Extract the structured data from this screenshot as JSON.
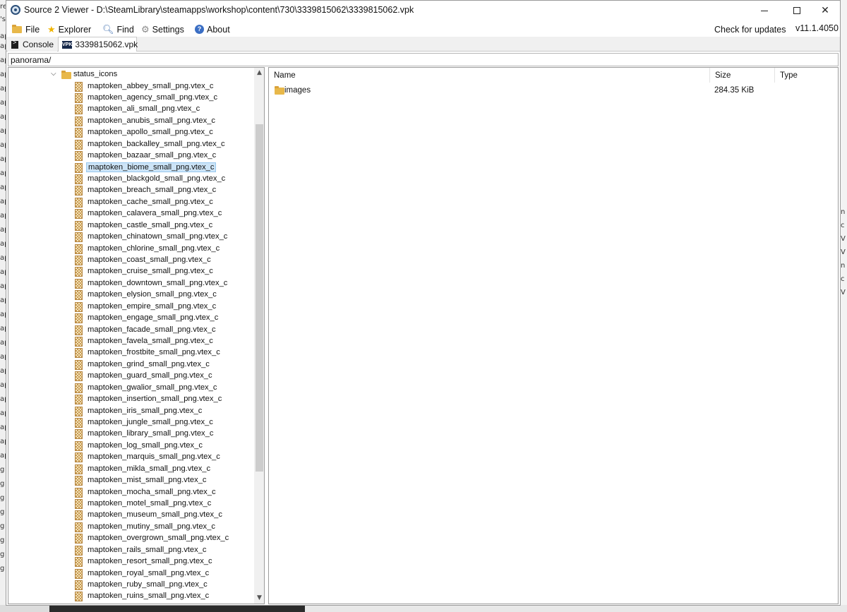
{
  "window": {
    "title": "Source 2 Viewer - D:\\SteamLibrary\\steamapps\\workshop\\content\\730\\3339815062\\3339815062.vpk",
    "controls": {
      "minimize": "minimize-icon",
      "maximize": "maximize-icon",
      "close": "✕"
    }
  },
  "menu": {
    "file": "File",
    "explorer": "Explorer",
    "find": "Find",
    "settings": "Settings",
    "about": "About",
    "check_updates": "Check for updates",
    "version": "v11.1.4050"
  },
  "tabs": [
    {
      "label": "Console",
      "icon": "console-icon"
    },
    {
      "label": "3339815062.vpk",
      "icon": "vpk-icon",
      "icon_text": "VPK",
      "active": true
    }
  ],
  "path": {
    "value": "panorama/"
  },
  "tree": {
    "folder": {
      "label": "status_icons",
      "expanded": true
    },
    "files": [
      "maptoken_abbey_small_png.vtex_c",
      "maptoken_agency_small_png.vtex_c",
      "maptoken_ali_small_png.vtex_c",
      "maptoken_anubis_small_png.vtex_c",
      "maptoken_apollo_small_png.vtex_c",
      "maptoken_backalley_small_png.vtex_c",
      "maptoken_bazaar_small_png.vtex_c",
      "maptoken_biome_small_png.vtex_c",
      "maptoken_blackgold_small_png.vtex_c",
      "maptoken_breach_small_png.vtex_c",
      "maptoken_cache_small_png.vtex_c",
      "maptoken_calavera_small_png.vtex_c",
      "maptoken_castle_small_png.vtex_c",
      "maptoken_chinatown_small_png.vtex_c",
      "maptoken_chlorine_small_png.vtex_c",
      "maptoken_coast_small_png.vtex_c",
      "maptoken_cruise_small_png.vtex_c",
      "maptoken_downtown_small_png.vtex_c",
      "maptoken_elysion_small_png.vtex_c",
      "maptoken_empire_small_png.vtex_c",
      "maptoken_engage_small_png.vtex_c",
      "maptoken_facade_small_png.vtex_c",
      "maptoken_favela_small_png.vtex_c",
      "maptoken_frostbite_small_png.vtex_c",
      "maptoken_grind_small_png.vtex_c",
      "maptoken_guard_small_png.vtex_c",
      "maptoken_gwalior_small_png.vtex_c",
      "maptoken_insertion_small_png.vtex_c",
      "maptoken_iris_small_png.vtex_c",
      "maptoken_jungle_small_png.vtex_c",
      "maptoken_library_small_png.vtex_c",
      "maptoken_log_small_png.vtex_c",
      "maptoken_marquis_small_png.vtex_c",
      "maptoken_mikla_small_png.vtex_c",
      "maptoken_mist_small_png.vtex_c",
      "maptoken_mocha_small_png.vtex_c",
      "maptoken_motel_small_png.vtex_c",
      "maptoken_museum_small_png.vtex_c",
      "maptoken_mutiny_small_png.vtex_c",
      "maptoken_overgrown_small_png.vtex_c",
      "maptoken_rails_small_png.vtex_c",
      "maptoken_resort_small_png.vtex_c",
      "maptoken_royal_small_png.vtex_c",
      "maptoken_ruby_small_png.vtex_c",
      "maptoken_ruins_small_png.vtex_c"
    ],
    "selected_index": 7
  },
  "list": {
    "columns": {
      "name": "Name",
      "size": "Size",
      "type": "Type"
    },
    "rows": [
      {
        "name": "images",
        "size": "284.35 KiB",
        "type": "",
        "icon": "folder-icon"
      }
    ]
  },
  "colors": {
    "selection_bg": "#cce4f7",
    "selection_border": "#99c9ef",
    "folder": "#e8b84a"
  }
}
